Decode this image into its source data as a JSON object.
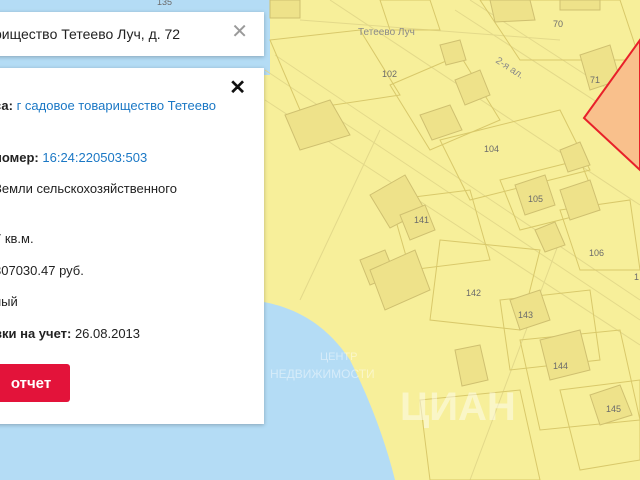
{
  "search": {
    "text": "риществo Тетеево Луч, д. 72",
    "close_icon": "close-icon"
  },
  "info": {
    "close_icon": "close-icon",
    "address_label": "са:",
    "address_value": "г садовое товарищество Тетеево",
    "cadnum_label": "номер:",
    "cadnum_value": "16:24:220503:503",
    "category": "Земли сельскохозяйственного",
    "area": "7 кв.м.",
    "cost": "307030.47 руб.",
    "status": "ный",
    "reg_label": "вки на учет:",
    "reg_value": "26.08.2013",
    "report_button": "отчет"
  },
  "map": {
    "street_name": "Тетеево Луч",
    "street_2": "2-я ал.",
    "parcels": [
      "135",
      "70",
      "102",
      "71",
      "104",
      "105",
      "141",
      "106",
      "142",
      "143",
      "144",
      "145",
      "1"
    ],
    "watermark_line1": "ЦЕНТР",
    "watermark_line2": "НЕДВИЖИМОСТИ",
    "watermark_brand": "ЦИАН",
    "colors": {
      "land": "#f7ef9a",
      "water": "#b4dcf5",
      "highlight": "#f9c08c",
      "highlight_border": "#e8202a"
    }
  }
}
